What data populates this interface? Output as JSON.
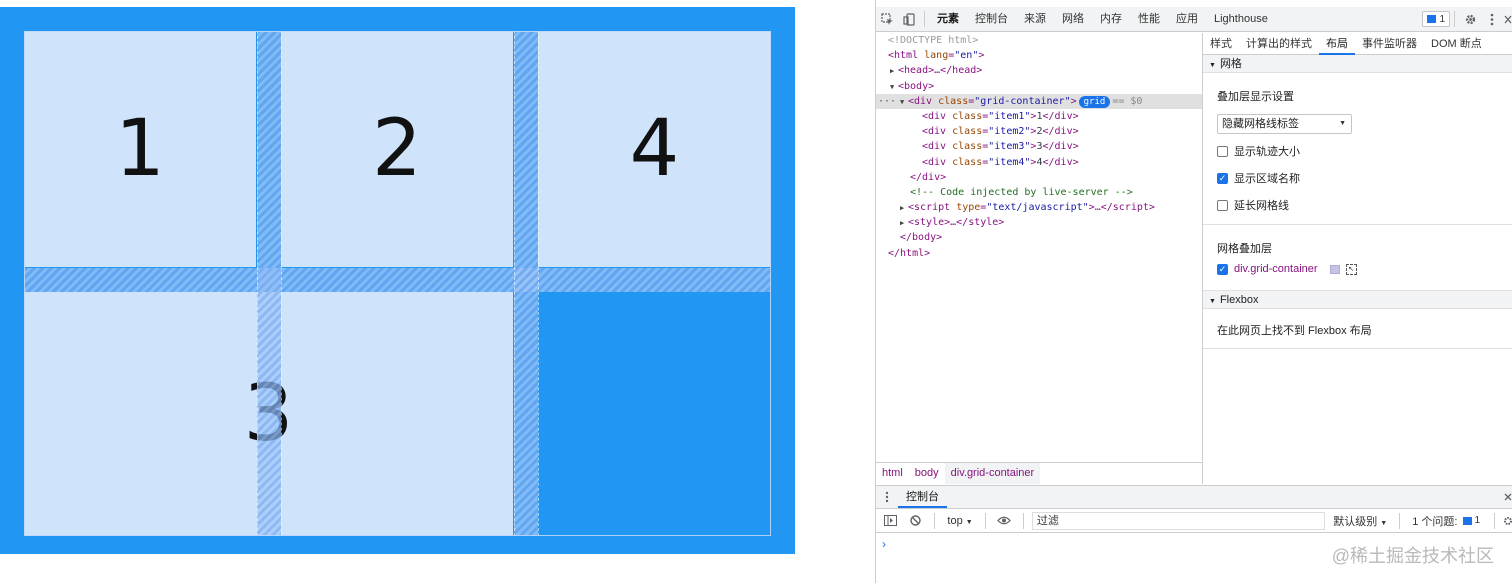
{
  "preview": {
    "items": [
      {
        "cls": "item1",
        "text": "1"
      },
      {
        "cls": "item2",
        "text": "2"
      },
      {
        "cls": "item4",
        "text": "4"
      },
      {
        "cls": "item3",
        "text": "3"
      }
    ],
    "colors": {
      "container_bg": "#2196f3",
      "item_bg": "#cfe3fb",
      "gap_overlay": "#8fb8f2"
    }
  },
  "devtools": {
    "toolbar": {
      "tabs": [
        "元素",
        "控制台",
        "来源",
        "网络",
        "内存",
        "性能",
        "应用",
        "Lighthouse"
      ],
      "active_tab": "元素",
      "issues_count": "1",
      "icons": [
        "inspect-icon",
        "device-toggle-icon",
        "settings-icon",
        "more-icon",
        "close-icon"
      ]
    },
    "tree": {
      "doctype": "<!DOCTYPE html>",
      "html_open": "<html",
      "lang_attr": "lang",
      "lang_val": "\"en\"",
      "head": "<head>…</head>",
      "body_open": "<body>",
      "div_open": "<div",
      "class_attr": "class",
      "class_val": "\"grid-container\"",
      "grid_badge": "grid",
      "selected_eq": "== $0",
      "children": [
        {
          "cls": "\"item1\"",
          "text": "1"
        },
        {
          "cls": "\"item2\"",
          "text": "2"
        },
        {
          "cls": "\"item3\"",
          "text": "3"
        },
        {
          "cls": "\"item4\"",
          "text": "4"
        }
      ],
      "div_close": "</div>",
      "comment": "<!-- Code injected by live-server -->",
      "script_type_attr": "type",
      "script_type_val": "\"text/javascript\"",
      "style": "<style>…</style>",
      "body_close": "</body>",
      "html_close": "</html>"
    },
    "breadcrumbs": [
      "html",
      "body",
      "div.grid-container"
    ],
    "side_tabs": [
      "样式",
      "计算出的样式",
      "布局",
      "事件监听器",
      "DOM 断点"
    ],
    "side_active": "布局",
    "layout": {
      "grid_section": "网格",
      "overlay_settings": "叠加层显示设置",
      "select_value": "隐藏网格线标签",
      "checkboxes": [
        {
          "label": "显示轨迹大小",
          "checked": false
        },
        {
          "label": "显示区域名称",
          "checked": true
        },
        {
          "label": "延长网格线",
          "checked": false
        }
      ],
      "overlays_title": "网格叠加层",
      "overlay_item": "div.grid-container",
      "overlay_checked": true,
      "overlay_color": "#c7c3e6",
      "flexbox_section": "Flexbox",
      "flexbox_empty": "在此网页上找不到 Flexbox 布局"
    },
    "console": {
      "drawer_tab": "控制台",
      "context": "top",
      "filter_placeholder": "过滤",
      "levels": "默认级别",
      "issues": "1 个问题:",
      "issues_count": "1",
      "prompt": "›"
    }
  },
  "watermark": "@稀土掘金技术社区"
}
